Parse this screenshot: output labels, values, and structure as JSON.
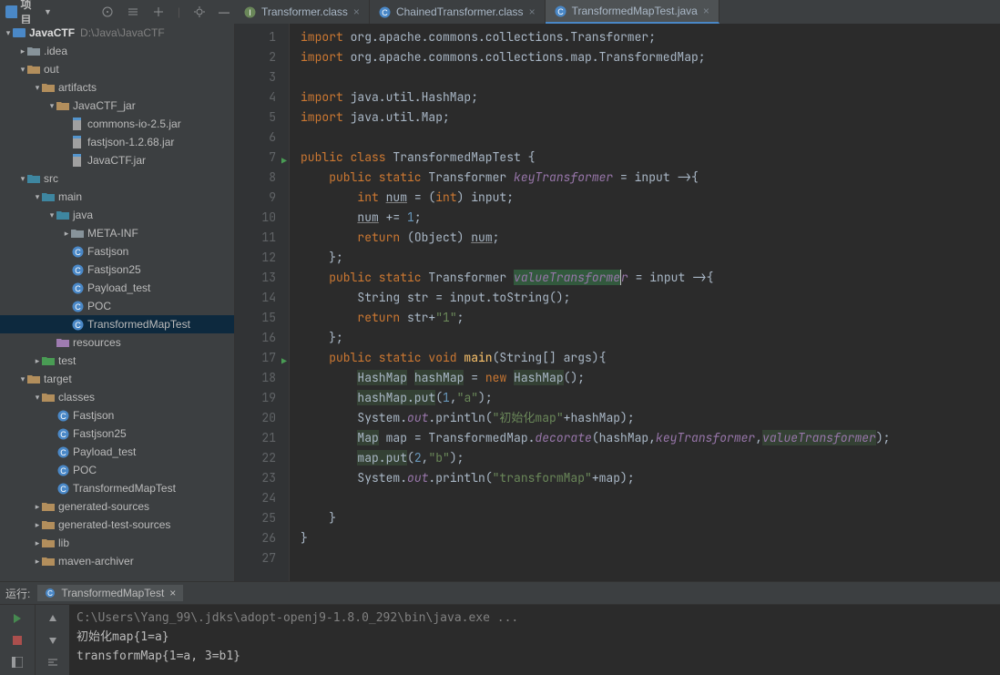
{
  "toolbar": {
    "project": "项目",
    "collapse": "—"
  },
  "sidebar": {
    "root": "JavaCTF",
    "root_hint": "D:\\Java\\JavaCTF",
    "nodes": [
      {
        "d": 1,
        "t": ">",
        "k": "folder-gray",
        "l": ".idea"
      },
      {
        "d": 1,
        "t": "v",
        "k": "folder",
        "l": "out"
      },
      {
        "d": 2,
        "t": "v",
        "k": "folder",
        "l": "artifacts"
      },
      {
        "d": 3,
        "t": "v",
        "k": "folder",
        "l": "JavaCTF_jar"
      },
      {
        "d": 4,
        "t": "",
        "k": "jar",
        "l": "commons-io-2.5.jar"
      },
      {
        "d": 4,
        "t": "",
        "k": "jar",
        "l": "fastjson-1.2.68.jar"
      },
      {
        "d": 4,
        "t": "",
        "k": "jar",
        "l": "JavaCTF.jar"
      },
      {
        "d": 1,
        "t": "v",
        "k": "folder-src",
        "l": "src"
      },
      {
        "d": 2,
        "t": "v",
        "k": "folder-src",
        "l": "main"
      },
      {
        "d": 3,
        "t": "v",
        "k": "folder-src",
        "l": "java"
      },
      {
        "d": 4,
        "t": ">",
        "k": "folder-gray",
        "l": "META-INF"
      },
      {
        "d": 4,
        "t": "",
        "k": "class",
        "l": "Fastjson"
      },
      {
        "d": 4,
        "t": "",
        "k": "class",
        "l": "Fastjson25"
      },
      {
        "d": 4,
        "t": "",
        "k": "class",
        "l": "Payload_test"
      },
      {
        "d": 4,
        "t": "",
        "k": "class",
        "l": "POC"
      },
      {
        "d": 4,
        "t": "",
        "k": "class",
        "l": "TransformedMapTest",
        "sel": true
      },
      {
        "d": 3,
        "t": "",
        "k": "folder-res",
        "l": "resources"
      },
      {
        "d": 2,
        "t": ">",
        "k": "folder-test",
        "l": "test"
      },
      {
        "d": 1,
        "t": "v",
        "k": "folder",
        "l": "target"
      },
      {
        "d": 2,
        "t": "v",
        "k": "folder",
        "l": "classes"
      },
      {
        "d": 3,
        "t": "",
        "k": "class",
        "l": "Fastjson"
      },
      {
        "d": 3,
        "t": "",
        "k": "class",
        "l": "Fastjson25"
      },
      {
        "d": 3,
        "t": "",
        "k": "class",
        "l": "Payload_test"
      },
      {
        "d": 3,
        "t": "",
        "k": "class",
        "l": "POC"
      },
      {
        "d": 3,
        "t": "",
        "k": "class",
        "l": "TransformedMapTest"
      },
      {
        "d": 2,
        "t": ">",
        "k": "folder",
        "l": "generated-sources"
      },
      {
        "d": 2,
        "t": ">",
        "k": "folder",
        "l": "generated-test-sources"
      },
      {
        "d": 2,
        "t": ">",
        "k": "folder",
        "l": "lib"
      },
      {
        "d": 2,
        "t": ">",
        "k": "folder",
        "l": "maven-archiver"
      }
    ]
  },
  "tabs": [
    {
      "label": "Transformer.class",
      "icon": "interface",
      "active": false
    },
    {
      "label": "ChainedTransformer.class",
      "icon": "class",
      "active": false
    },
    {
      "label": "TransformedMapTest.java",
      "icon": "class",
      "active": true
    }
  ],
  "code": {
    "lines": [
      [
        {
          "t": "import ",
          "c": "k-key"
        },
        {
          "t": "org.apache.commons.collections.Transformer;"
        }
      ],
      [
        {
          "t": "import ",
          "c": "k-key"
        },
        {
          "t": "org.apache.commons.collections.map.TransformedMap;"
        }
      ],
      [],
      [
        {
          "t": "import ",
          "c": "k-key"
        },
        {
          "t": "java.util.HashMap;"
        }
      ],
      [
        {
          "t": "import ",
          "c": "k-key"
        },
        {
          "t": "java.util.Map;"
        }
      ],
      [],
      [
        {
          "t": "public class ",
          "c": "k-key"
        },
        {
          "t": "TransformedMapTest {"
        }
      ],
      [
        {
          "t": "    "
        },
        {
          "t": "public static ",
          "c": "k-key"
        },
        {
          "t": "Transformer "
        },
        {
          "t": "keyTransformer",
          "c": "k-fld"
        },
        {
          "t": " = input ->{"
        }
      ],
      [
        {
          "t": "        "
        },
        {
          "t": "int ",
          "c": "k-key"
        },
        {
          "t": "num",
          "c": "k-und"
        },
        {
          "t": " = ("
        },
        {
          "t": "int",
          "c": "k-key"
        },
        {
          "t": ") input;"
        }
      ],
      [
        {
          "t": "        "
        },
        {
          "t": "num",
          "c": "k-und"
        },
        {
          "t": " += "
        },
        {
          "t": "1",
          "c": "k-num"
        },
        {
          "t": ";"
        }
      ],
      [
        {
          "t": "        "
        },
        {
          "t": "return ",
          "c": "k-key"
        },
        {
          "t": "(Object) "
        },
        {
          "t": "num",
          "c": "k-und"
        },
        {
          "t": ";"
        }
      ],
      [
        {
          "t": "    };"
        }
      ],
      [
        {
          "t": "    "
        },
        {
          "t": "public static ",
          "c": "k-key"
        },
        {
          "t": "Transformer "
        },
        {
          "t": "valueTransforme",
          "c": "k-fld hl-decl"
        },
        {
          "t": "r",
          "c": "k-fld caret"
        },
        {
          "t": " = input ->{"
        }
      ],
      [
        {
          "t": "        String str = input.toString();"
        }
      ],
      [
        {
          "t": "        "
        },
        {
          "t": "return ",
          "c": "k-key"
        },
        {
          "t": "str+"
        },
        {
          "t": "\"1\"",
          "c": "k-str"
        },
        {
          "t": ";"
        }
      ],
      [
        {
          "t": "    };"
        }
      ],
      [
        {
          "t": "    "
        },
        {
          "t": "public static void ",
          "c": "k-key"
        },
        {
          "t": "main",
          "c": "k-mtd"
        },
        {
          "t": "(String[] args){"
        }
      ],
      [
        {
          "t": "        "
        },
        {
          "t": "HashMap",
          "c": "hl-use"
        },
        {
          "t": " "
        },
        {
          "t": "hashMap",
          "c": "hl-use"
        },
        {
          "t": " = "
        },
        {
          "t": "new ",
          "c": "k-key"
        },
        {
          "t": "HashMap",
          "c": "hl-use"
        },
        {
          "t": "();"
        }
      ],
      [
        {
          "t": "        "
        },
        {
          "t": "hashMap.put",
          "c": "hl-use"
        },
        {
          "t": "("
        },
        {
          "t": "1",
          "c": "k-num"
        },
        {
          "t": ","
        },
        {
          "t": "\"a\"",
          "c": "k-str"
        },
        {
          "t": ");"
        }
      ],
      [
        {
          "t": "        System."
        },
        {
          "t": "out",
          "c": "k-fld"
        },
        {
          "t": ".println("
        },
        {
          "t": "\"初始化map\"",
          "c": "k-str"
        },
        {
          "t": "+hashMap);"
        }
      ],
      [
        {
          "t": "        "
        },
        {
          "t": "Map",
          "c": "hl-use"
        },
        {
          "t": " map = TransformedMap."
        },
        {
          "t": "decorate",
          "c": "k-fld"
        },
        {
          "t": "(hashMap,"
        },
        {
          "t": "keyTransformer",
          "c": "k-fld"
        },
        {
          "t": ","
        },
        {
          "t": "valueTransformer",
          "c": "k-fld hl-use"
        },
        {
          "t": ");"
        }
      ],
      [
        {
          "t": "        "
        },
        {
          "t": "map.put",
          "c": "hl-use"
        },
        {
          "t": "("
        },
        {
          "t": "2",
          "c": "k-num"
        },
        {
          "t": ","
        },
        {
          "t": "\"b\"",
          "c": "k-str"
        },
        {
          "t": ");"
        }
      ],
      [
        {
          "t": "        System."
        },
        {
          "t": "out",
          "c": "k-fld"
        },
        {
          "t": ".println("
        },
        {
          "t": "\"transformMap\"",
          "c": "k-str"
        },
        {
          "t": "+map);"
        }
      ],
      [],
      [
        {
          "t": "    }"
        }
      ],
      [
        {
          "t": "}"
        }
      ],
      []
    ],
    "runmarks": [
      7,
      17
    ]
  },
  "run": {
    "label": "运行:",
    "tab": "TransformedMapTest",
    "out": [
      {
        "t": "C:\\Users\\Yang_99\\.jdks\\adopt-openj9-1.8.0_292\\bin\\java.exe ...",
        "c": "gray"
      },
      {
        "t": "初始化map{1=a}"
      },
      {
        "t": "transformMap{1=a, 3=b1}"
      }
    ]
  }
}
